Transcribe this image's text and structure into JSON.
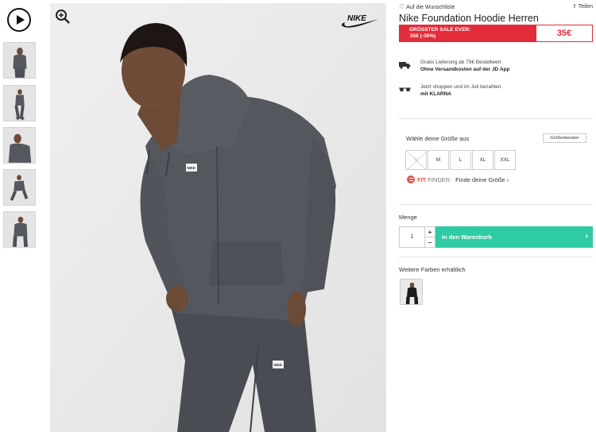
{
  "gallery": {
    "play_icon": "play-circle-icon",
    "thumbnail_count": 5
  },
  "main_image": {
    "zoom_icon": "zoom-in-icon",
    "brand": "NIKE",
    "garment_badge": "NIKE"
  },
  "header": {
    "wishlist_label": "Auf die Wunschliste",
    "share_label": "Teilen"
  },
  "product": {
    "title": "Nike Foundation Hoodie Herren",
    "sale_line1": "GRÖSSTER SALE EVER:",
    "sale_line2": "55€   (-36%)",
    "price_now": "35€"
  },
  "info": [
    {
      "icon": "delivery-truck-icon",
      "line1": "Gratis Lieferung ab 75€ Bestellwert",
      "line2": "Ohne Versandkosten auf der JD App"
    },
    {
      "icon": "glasses-icon",
      "line1": "Jetzt shoppen und im Juli bezahlen",
      "line2": "mit KLARNA"
    }
  ],
  "sizes": {
    "label": "Wähle deine Größe aus",
    "guide_label": "Größenberater",
    "options": [
      "S",
      "M",
      "L",
      "XL",
      "XXL"
    ],
    "unavailable": [
      "S"
    ],
    "fit_finder_fit": "FIT",
    "fit_finder_finder": "FINDER",
    "fit_finder_link": "Finde deine Größe ›"
  },
  "quantity": {
    "label": "Menge",
    "value": "1",
    "plus": "+",
    "minus": "−"
  },
  "cart": {
    "add_label": "In den Warenkorb",
    "chevron": "›"
  },
  "colors": {
    "label": "Weitere Farben erhältlich"
  },
  "colors_palette": {
    "sale_red": "#e22c3a",
    "cart_green": "#2fcba4",
    "fit_finder_red": "#e6504a"
  }
}
